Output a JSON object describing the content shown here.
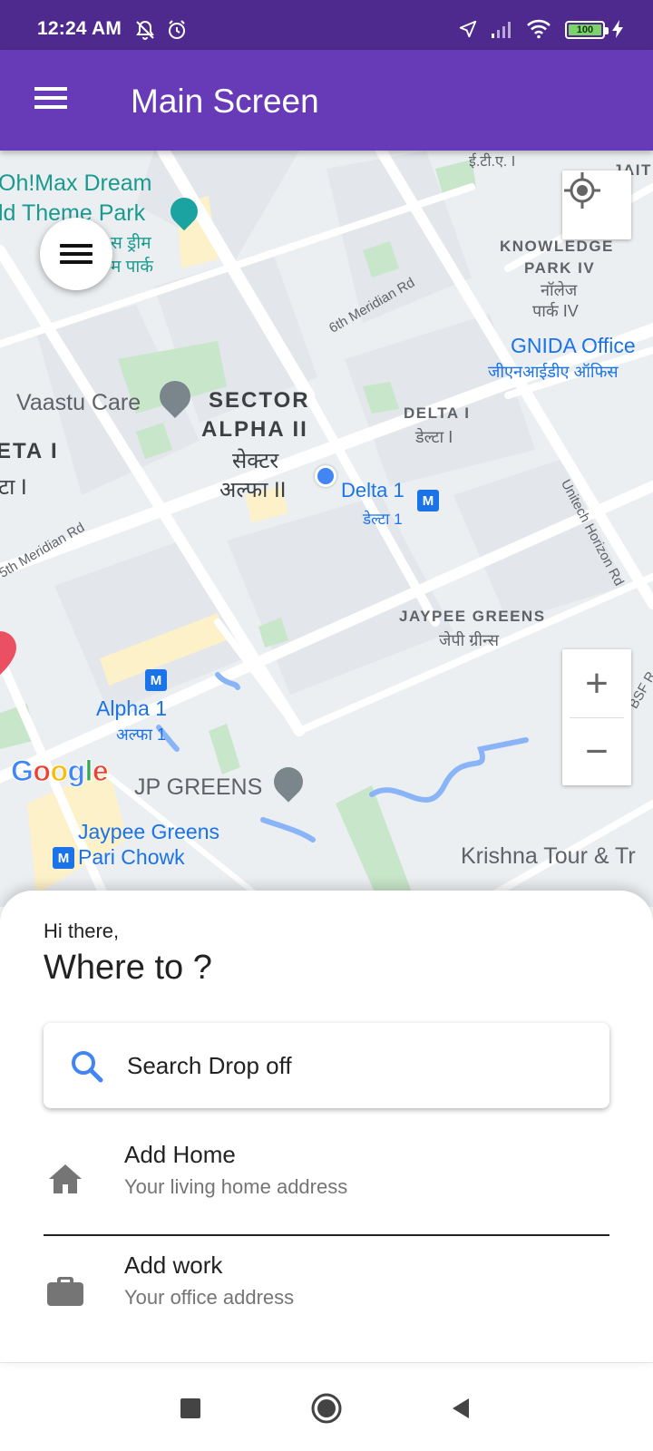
{
  "status_bar": {
    "time": "12:24 AM",
    "icons": [
      "mute-bell-icon",
      "alarm-icon",
      "location-arrow-icon",
      "signal-icon",
      "wifi-icon",
      "battery-icon",
      "charging-icon"
    ],
    "battery_label": "100"
  },
  "app_bar": {
    "title": "Main Screen",
    "menu_icon": "hamburger-menu-icon"
  },
  "map": {
    "labels": {
      "ohmax": "Oh!Max Dream",
      "theme_park": "ld Theme Park",
      "ohmax_hi1": "स ड्रीम",
      "ohmax_hi2": "म पार्क",
      "knowledge": "KNOWLEDGE",
      "park_iv": "PARK IV",
      "knowledge_hi1": "नॉलेज",
      "knowledge_hi2": "पार्क IV",
      "ett": "ई.टी.ए. I",
      "jait": "JAIT",
      "gnida": "GNIDA Office",
      "gnida_hi": "जीएनआईडीए ऑफिस",
      "vaastu": "Vaastu Care",
      "sector_alpha_1": "SECTOR",
      "sector_alpha_2": "ALPHA II",
      "sector_hi1": "सेक्टर",
      "sector_hi2": "अल्फा II",
      "delta_i": "DELTA I",
      "delta_hi": "डेल्टा I",
      "eta_i": "ETA I",
      "eta_hi": "टा I",
      "delta1": "Delta 1",
      "delta1_hi": "डेल्टा 1",
      "meridian_6th": "6th Meridian Rd",
      "meridian_5th": "5th Meridian Rd",
      "unitech": "Unitech Horizon Rd",
      "jaypee": "JAYPEE GREENS",
      "jaypee_hi": "जेपी ग्रीन्स",
      "alpha1": "Alpha 1",
      "alpha1_hi": "अल्फा 1",
      "jp_greens": "JP GREENS",
      "jaypee_greens": "Jaypee Greens",
      "pari_chowk": "Pari Chowk",
      "krishna": "Krishna Tour & Tr",
      "bsf": "BSF R"
    },
    "google_letters": [
      "G",
      "o",
      "o",
      "g",
      "l",
      "e"
    ],
    "metro_label": "M",
    "zoom_in": "+",
    "zoom_out": "−"
  },
  "sheet": {
    "greeting": "Hi there,",
    "heading": "Where to ?",
    "search_placeholder": "Search Drop off",
    "places": [
      {
        "title": "Add Home",
        "subtitle": "Your living home address",
        "icon": "home-icon"
      },
      {
        "title": "Add work",
        "subtitle": "Your office address",
        "icon": "briefcase-icon"
      }
    ]
  },
  "colors": {
    "status_bar": "#4e2a8e",
    "app_bar": "#673ab7",
    "accent_blue": "#4285f4",
    "map_bg": "#eceff1"
  }
}
